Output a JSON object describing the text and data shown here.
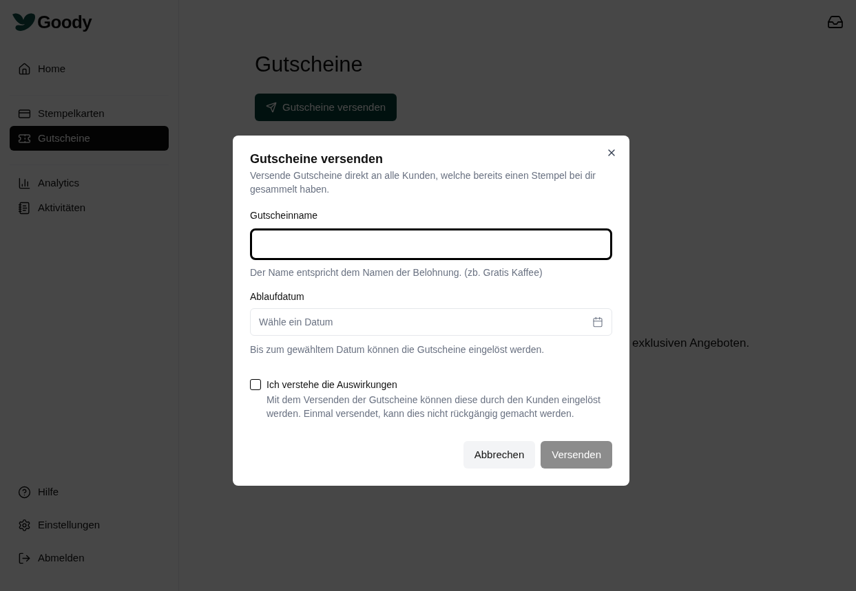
{
  "brand": {
    "name": "Goody"
  },
  "sidebar": {
    "groups": [
      {
        "items": [
          {
            "label": "Home",
            "selected": false
          }
        ]
      },
      {
        "items": [
          {
            "label": "Stempelkarten",
            "selected": false
          },
          {
            "label": "Gutscheine",
            "selected": true
          }
        ]
      },
      {
        "items": [
          {
            "label": "Analytics",
            "selected": false
          },
          {
            "label": "Aktivitäten",
            "selected": false
          }
        ]
      }
    ],
    "footer_items": [
      {
        "label": "Hilfe"
      },
      {
        "label": "Einstellungen"
      },
      {
        "label": "Abmelden"
      }
    ]
  },
  "page": {
    "title": "Gutscheine",
    "action_button": "Gutscheine versenden",
    "partial_text": "exklusiven Angeboten."
  },
  "dialog": {
    "title": "Gutscheine versenden",
    "description": "Versende Gutscheine direkt an alle Kunden, welche bereits einen Stempel bei dir gesammelt haben.",
    "name_field": {
      "label": "Gutscheinname",
      "focused": true,
      "hint": "Der Name entspricht dem Namen der Belohnung. (zb. Gratis Kaffee)"
    },
    "date_field": {
      "label": "Ablaufdatum",
      "placeholder": "Wähle ein Datum",
      "hint": "Bis zum gewähltem Datum können die Gutscheine eingelöst werden."
    },
    "confirm": {
      "label": "Ich verstehe die Auswirkungen",
      "checked": false,
      "description": "Mit dem Versenden der Gutscheine können diese durch den Kunden eingelöst werden. Einmal versendet, kann dies nicht rückgängig gemacht werden."
    },
    "cancel_button": "Abbrechen",
    "submit_button": {
      "label": "Versenden",
      "disabled": true
    }
  }
}
